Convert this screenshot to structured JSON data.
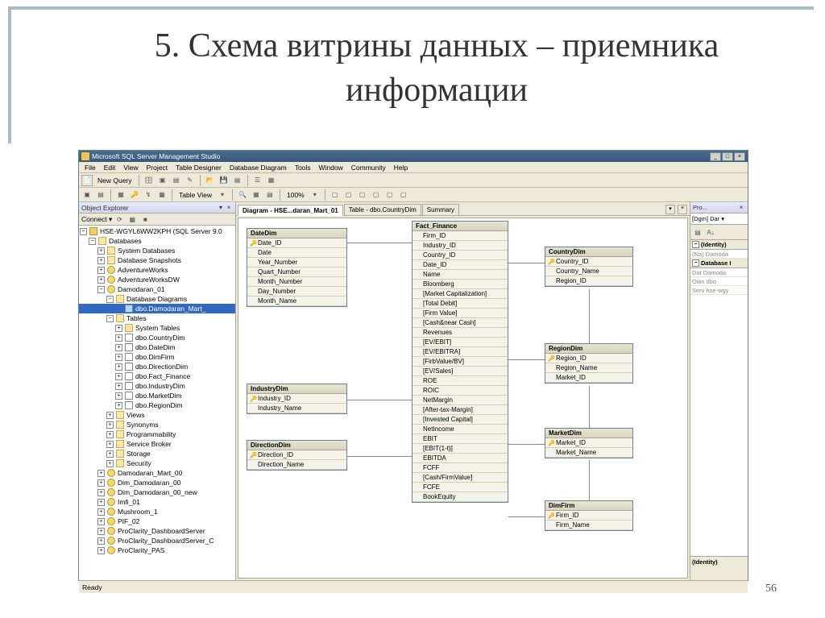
{
  "slide": {
    "title": "5. Схема витрины данных – приемника информации",
    "page_number": "56"
  },
  "ssms": {
    "title": "Microsoft SQL Server Management Studio",
    "menu": [
      "File",
      "Edit",
      "View",
      "Project",
      "Table Designer",
      "Database Diagram",
      "Tools",
      "Window",
      "Community",
      "Help"
    ],
    "toolbar1": {
      "new_query": "New Query"
    },
    "toolbar2": {
      "table_view": "Table View",
      "zoom": "100%"
    },
    "status": "Ready",
    "object_explorer": {
      "title": "Object Explorer",
      "connect": "Connect ▾",
      "root": "HSE-WGYL6WW2KPH (SQL Server 9.0",
      "databases": "Databases",
      "sys_db": "System Databases",
      "snap": "Database Snapshots",
      "aw": "AdventureWorks",
      "awdw": "AdventureWorksDW",
      "damo": "Damodaran_01",
      "dd": "Database Diagrams",
      "diag": "dbo.Damodaran_Mart_",
      "tables_node": "Tables",
      "systables": "System Tables",
      "t1": "dbo.CountryDim",
      "t2": "dbo.DateDim",
      "t3": "dbo.DimFirm",
      "t4": "dbo.DirectionDim",
      "t5": "dbo.Fact_Finance",
      "t6": "dbo.IndustryDim",
      "t7": "dbo.MarketDim",
      "t8": "dbo.RegionDim",
      "views": "Views",
      "syn": "Synonyms",
      "prog": "Programmability",
      "sbroker": "Service Broker",
      "storage": "Storage",
      "security": "Security",
      "dm00": "Damodaran_Mart_00",
      "dd00": "Dim_Damodaran_00",
      "dd00n": "Dim_Damodaran_00_new",
      "imfi": "Imfi_01",
      "mush": "Mushroom_1",
      "pif": "PIF_02",
      "pds": "ProClarity_DashboardServer",
      "pdc": "ProClarity_DashboardServer_C",
      "ppas": "ProClarity_PAS"
    },
    "tabs": {
      "t1": "Diagram - HSE...daran_Mart_01",
      "t2": "Table - dbo.CountryDim",
      "t3": "Summary"
    },
    "tables": {
      "DateDim": {
        "title": "DateDim",
        "cols": [
          "Date_ID",
          "Date",
          "Year_Number",
          "Quart_Number",
          "Month_Number",
          "Day_Number",
          "Month_Name"
        ],
        "keys": [
          "Date_ID"
        ]
      },
      "IndustryDim": {
        "title": "IndustryDim",
        "cols": [
          "Industry_ID",
          "Industry_Name"
        ],
        "keys": [
          "Industry_ID"
        ]
      },
      "DirectionDim": {
        "title": "DirectionDim",
        "cols": [
          "Direction_ID",
          "Direction_Name"
        ],
        "keys": [
          "Direction_ID"
        ]
      },
      "Fact_Finance": {
        "title": "Fact_Finance",
        "cols": [
          "Firm_ID",
          "Industry_ID",
          "Country_ID",
          "Date_ID",
          "Name",
          "Bloomberg",
          "[Market Capitalization]",
          "[Total Debit]",
          "[Firm Value]",
          "[Cash&near Cash]",
          "Revenues",
          "[EV/EBIT]",
          "[EV/EBITRA]",
          "[FirbValue/BV]",
          "[EV/Sales]",
          "ROE",
          "ROIC",
          "NetMargin",
          "[After-tax-Margin]",
          "[Invested Capital]",
          "NetIncome",
          "EBIT",
          "[EBIT(1-t)]",
          "EBITDA",
          "FCFF",
          "[Cash/FirmValue]",
          "FCFE",
          "BookEquity"
        ]
      },
      "CountryDim": {
        "title": "CountryDim",
        "cols": [
          "Country_ID",
          "Country_Name",
          "Region_ID"
        ],
        "keys": [
          "Country_ID"
        ]
      },
      "RegionDim": {
        "title": "RegionDim",
        "cols": [
          "Region_ID",
          "Region_Name",
          "Market_ID"
        ],
        "keys": [
          "Region_ID"
        ]
      },
      "MarketDim": {
        "title": "MarketDim",
        "cols": [
          "Market_ID",
          "Market_Name"
        ],
        "keys": [
          "Market_ID"
        ]
      },
      "DimFirm": {
        "title": "DimFirm",
        "cols": [
          "Firm_ID",
          "Firm_Name"
        ],
        "keys": [
          "Firm_ID"
        ]
      }
    },
    "properties": {
      "title": "Pro...",
      "subtitle": "[Dgm] Dar",
      "cat1": "(Identity)",
      "r1": "(Na) Damoda",
      "cat2": "Database I",
      "r2": "Dat Damoda",
      "r3": "Own dbo",
      "r4": "Serv hse-wgy",
      "identity": "(Identity)"
    }
  }
}
